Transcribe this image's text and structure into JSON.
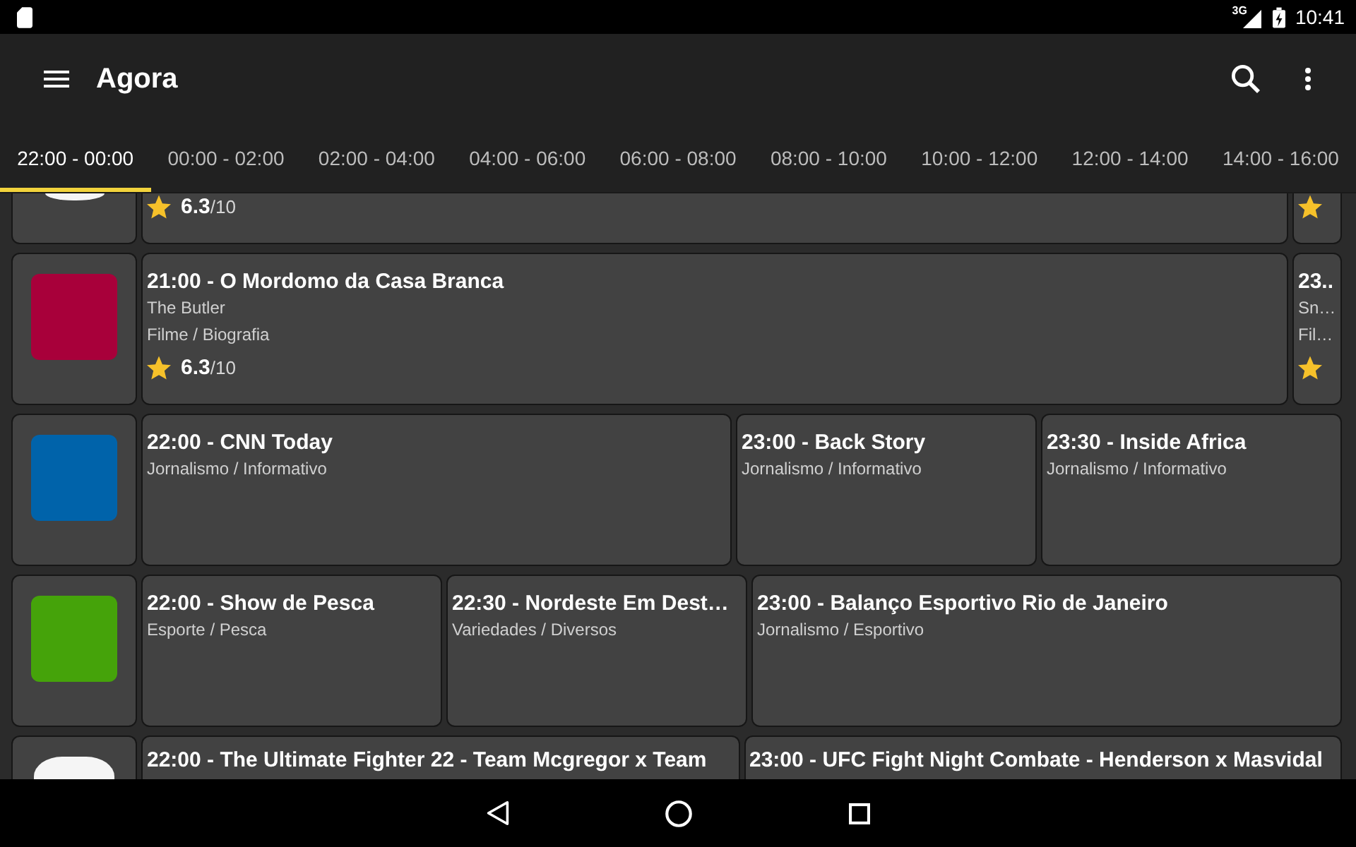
{
  "status_bar": {
    "network": "3G",
    "time": "10:41"
  },
  "toolbar": {
    "title": "Agora"
  },
  "tabs": [
    {
      "label": "22:00 - 00:00",
      "selected": true
    },
    {
      "label": "00:00 - 02:00",
      "selected": false
    },
    {
      "label": "02:00 - 04:00",
      "selected": false
    },
    {
      "label": "04:00 - 06:00",
      "selected": false
    },
    {
      "label": "06:00 - 08:00",
      "selected": false
    },
    {
      "label": "08:00 - 10:00",
      "selected": false
    },
    {
      "label": "10:00 - 12:00",
      "selected": false
    },
    {
      "label": "12:00 - 14:00",
      "selected": false
    },
    {
      "label": "14:00 - 16:00",
      "selected": false
    }
  ],
  "channels": [
    {
      "color": "#f5f5f5",
      "programs": [
        {
          "kind": "full",
          "rated": true,
          "rating": "**6.3**/10"
        },
        {
          "kind": "sliver",
          "rated": true
        }
      ]
    },
    {
      "color": "#a8003a",
      "programs": [
        {
          "kind": "full",
          "title": "21:00 - O Mordomo da Casa Branca",
          "subtitle": "The Butler",
          "genre": "Filme / Biografia",
          "rated": true,
          "rating": "**6.3**/10"
        },
        {
          "kind": "sliver",
          "title": "23..",
          "subtitle": "Sn…",
          "genre": "Fil…",
          "rated": true
        }
      ]
    },
    {
      "color": "#0063aa",
      "programs": [
        {
          "kind": "double",
          "title": "22:00 - CNN Today",
          "genre": "Jornalismo / Informativo",
          "rated": false
        },
        {
          "kind": "single",
          "title": "23:00 - Back Story",
          "genre": "Jornalismo / Informativo",
          "rated": false
        },
        {
          "kind": "single",
          "title": "23:30 - Inside Africa",
          "genre": "Jornalismo / Informativo",
          "rated": false
        }
      ]
    },
    {
      "color": "#45a30a",
      "programs": [
        {
          "kind": "single",
          "title": "22:00 - Show de Pesca",
          "genre": "Esporte / Pesca",
          "rated": false
        },
        {
          "kind": "single",
          "title": "22:30 - Nordeste Em Dest…",
          "genre": "Variedades / Diversos",
          "rated": false
        },
        {
          "kind": "double",
          "title": "23:00 - Balanço Esportivo Rio de Janeiro",
          "genre": "Jornalismo / Esportivo",
          "rated": false
        }
      ]
    },
    {
      "color": "#f5f5f5",
      "programs": [
        {
          "kind": "double",
          "title": "22:00 - The Ultimate Fighter 22 - Team Mcgregor x Team"
        },
        {
          "kind": "double",
          "title": "23:00 - UFC Fight Night Combate - Henderson x Masvidal"
        }
      ]
    }
  ]
}
